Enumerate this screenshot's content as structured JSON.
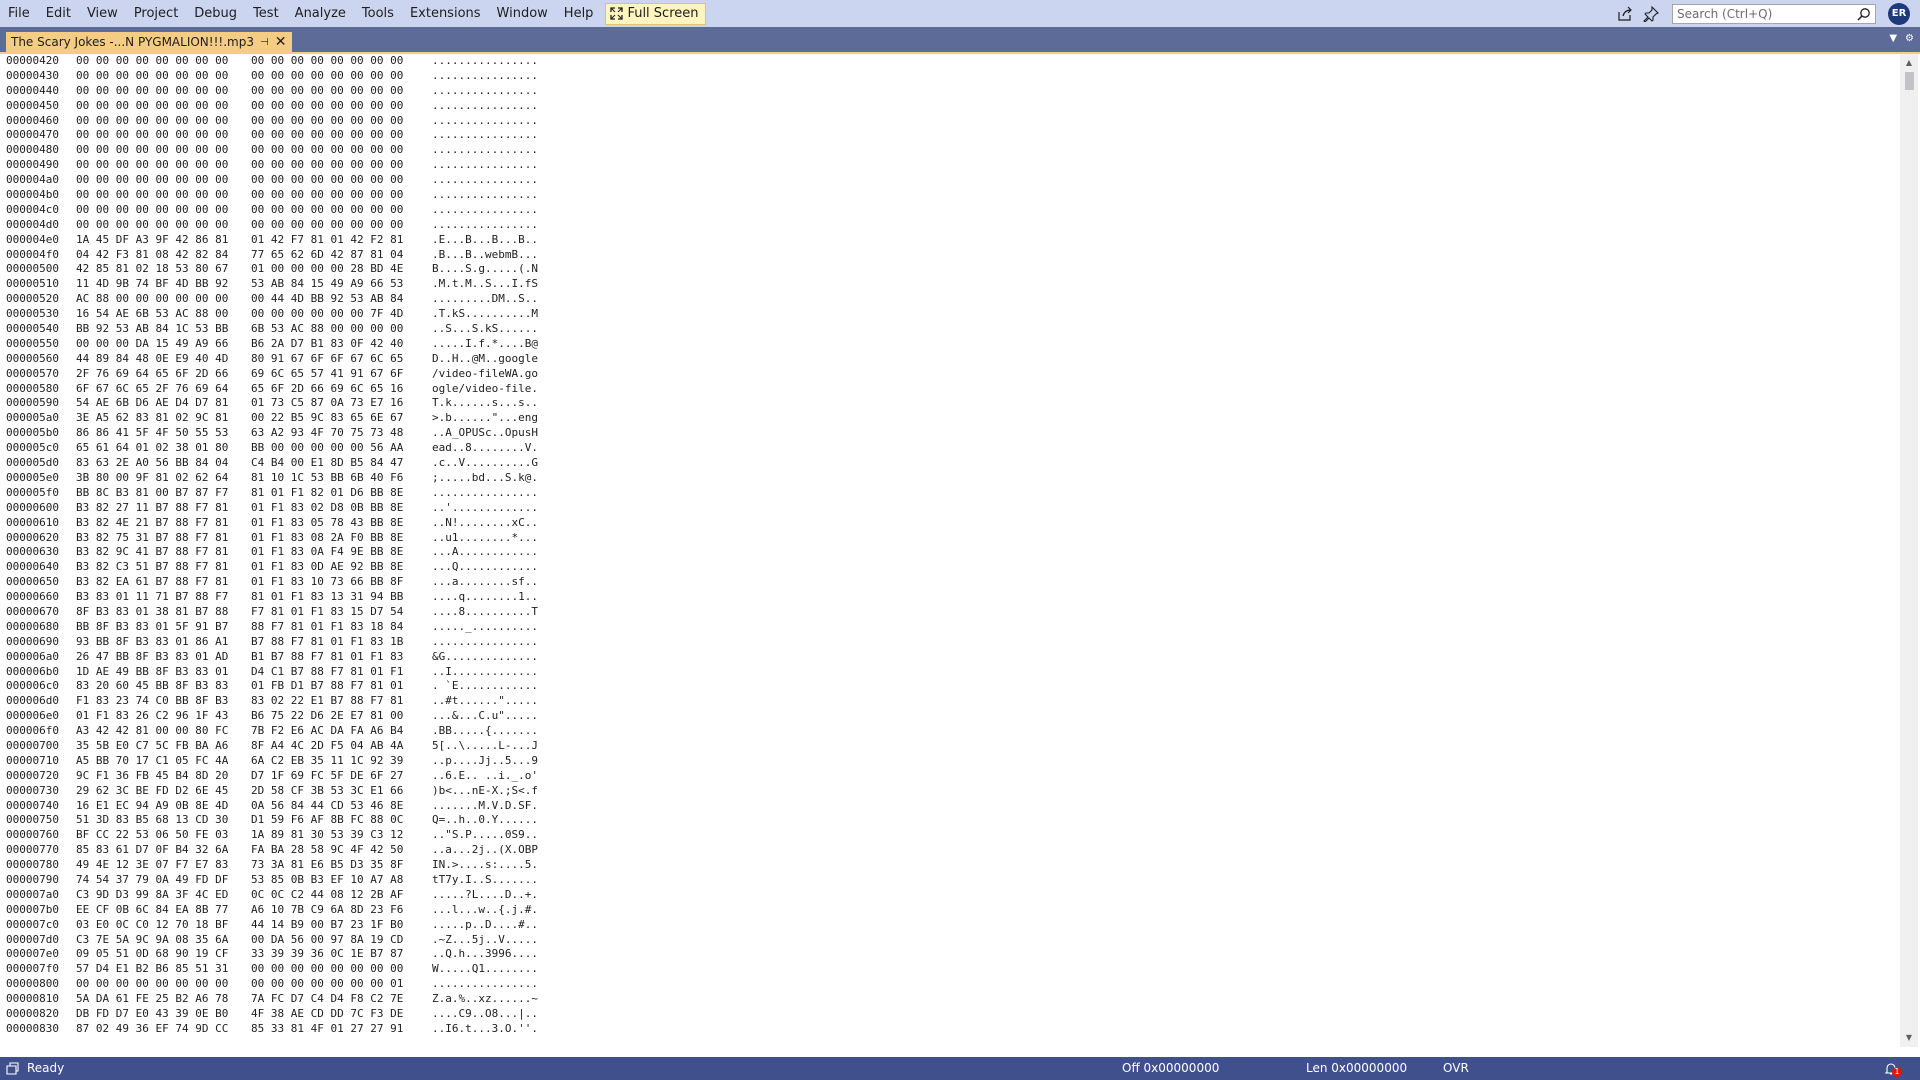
{
  "menubar": {
    "items": [
      "File",
      "Edit",
      "View",
      "Project",
      "Debug",
      "Test",
      "Analyze",
      "Tools",
      "Extensions",
      "Window",
      "Help"
    ],
    "fullscreen_label": "Full Screen",
    "search_placeholder": "Search (Ctrl+Q)",
    "avatar_initials": "ER"
  },
  "tab": {
    "title": "The Scary Jokes -...N PYGMALION!!!.mp3",
    "pin_glyph": "⊣",
    "close_glyph": "✕"
  },
  "hex_rows": [
    {
      "offset": "00000420",
      "hex1": "00 00 00 00 00 00 00 00",
      "hex2": "00 00 00 00 00 00 00 00",
      "ascii": "................"
    },
    {
      "offset": "00000430",
      "hex1": "00 00 00 00 00 00 00 00",
      "hex2": "00 00 00 00 00 00 00 00",
      "ascii": "................"
    },
    {
      "offset": "00000440",
      "hex1": "00 00 00 00 00 00 00 00",
      "hex2": "00 00 00 00 00 00 00 00",
      "ascii": "................"
    },
    {
      "offset": "00000450",
      "hex1": "00 00 00 00 00 00 00 00",
      "hex2": "00 00 00 00 00 00 00 00",
      "ascii": "................"
    },
    {
      "offset": "00000460",
      "hex1": "00 00 00 00 00 00 00 00",
      "hex2": "00 00 00 00 00 00 00 00",
      "ascii": "................"
    },
    {
      "offset": "00000470",
      "hex1": "00 00 00 00 00 00 00 00",
      "hex2": "00 00 00 00 00 00 00 00",
      "ascii": "................"
    },
    {
      "offset": "00000480",
      "hex1": "00 00 00 00 00 00 00 00",
      "hex2": "00 00 00 00 00 00 00 00",
      "ascii": "................"
    },
    {
      "offset": "00000490",
      "hex1": "00 00 00 00 00 00 00 00",
      "hex2": "00 00 00 00 00 00 00 00",
      "ascii": "................"
    },
    {
      "offset": "000004a0",
      "hex1": "00 00 00 00 00 00 00 00",
      "hex2": "00 00 00 00 00 00 00 00",
      "ascii": "................"
    },
    {
      "offset": "000004b0",
      "hex1": "00 00 00 00 00 00 00 00",
      "hex2": "00 00 00 00 00 00 00 00",
      "ascii": "................"
    },
    {
      "offset": "000004c0",
      "hex1": "00 00 00 00 00 00 00 00",
      "hex2": "00 00 00 00 00 00 00 00",
      "ascii": "................"
    },
    {
      "offset": "000004d0",
      "hex1": "00 00 00 00 00 00 00 00",
      "hex2": "00 00 00 00 00 00 00 00",
      "ascii": "................"
    },
    {
      "offset": "000004e0",
      "hex1": "1A 45 DF A3 9F 42 86 81",
      "hex2": "01 42 F7 81 01 42 F2 81",
      "ascii": ".E...B...B...B.."
    },
    {
      "offset": "000004f0",
      "hex1": "04 42 F3 81 08 42 82 84",
      "hex2": "77 65 62 6D 42 87 81 04",
      "ascii": ".B...B..webmB..."
    },
    {
      "offset": "00000500",
      "hex1": "42 85 81 02 18 53 80 67",
      "hex2": "01 00 00 00 00 28 BD 4E",
      "ascii": "B....S.g.....(.N"
    },
    {
      "offset": "00000510",
      "hex1": "11 4D 9B 74 BF 4D BB 92",
      "hex2": "53 AB 84 15 49 A9 66 53",
      "ascii": ".M.t.M..S...I.fS"
    },
    {
      "offset": "00000520",
      "hex1": "AC 88 00 00 00 00 00 00",
      "hex2": "00 44 4D BB 92 53 AB 84",
      "ascii": ".........DM..S.."
    },
    {
      "offset": "00000530",
      "hex1": "16 54 AE 6B 53 AC 88 00",
      "hex2": "00 00 00 00 00 00 7F 4D",
      "ascii": ".T.kS..........M"
    },
    {
      "offset": "00000540",
      "hex1": "BB 92 53 AB 84 1C 53 BB",
      "hex2": "6B 53 AC 88 00 00 00 00",
      "ascii": "..S...S.kS......"
    },
    {
      "offset": "00000550",
      "hex1": "00 00 00 DA 15 49 A9 66",
      "hex2": "B6 2A D7 B1 83 0F 42 40",
      "ascii": ".....I.f.*....B@"
    },
    {
      "offset": "00000560",
      "hex1": "44 89 84 48 0E E9 40 4D",
      "hex2": "80 91 67 6F 6F 67 6C 65",
      "ascii": "D..H..@M..google"
    },
    {
      "offset": "00000570",
      "hex1": "2F 76 69 64 65 6F 2D 66",
      "hex2": "69 6C 65 57 41 91 67 6F",
      "ascii": "/video-fileWA.go"
    },
    {
      "offset": "00000580",
      "hex1": "6F 67 6C 65 2F 76 69 64",
      "hex2": "65 6F 2D 66 69 6C 65 16",
      "ascii": "ogle/video-file."
    },
    {
      "offset": "00000590",
      "hex1": "54 AE 6B D6 AE D4 D7 81",
      "hex2": "01 73 C5 87 0A 73 E7 16",
      "ascii": "T.k......s...s.."
    },
    {
      "offset": "000005a0",
      "hex1": "3E A5 62 83 81 02 9C 81",
      "hex2": "00 22 B5 9C 83 65 6E 67",
      "ascii": ">.b......\"...eng"
    },
    {
      "offset": "000005b0",
      "hex1": "86 86 41 5F 4F 50 55 53",
      "hex2": "63 A2 93 4F 70 75 73 48",
      "ascii": "..A_OPUSc..OpusH"
    },
    {
      "offset": "000005c0",
      "hex1": "65 61 64 01 02 38 01 80",
      "hex2": "BB 00 00 00 00 00 56 AA",
      "ascii": "ead..8........V."
    },
    {
      "offset": "000005d0",
      "hex1": "83 63 2E A0 56 BB 84 04",
      "hex2": "C4 B4 00 E1 8D B5 84 47",
      "ascii": ".c..V..........G"
    },
    {
      "offset": "000005e0",
      "hex1": "3B 80 00 9F 81 02 62 64",
      "hex2": "81 10 1C 53 BB 6B 40 F6",
      "ascii": ";.....bd...S.k@."
    },
    {
      "offset": "000005f0",
      "hex1": "BB 8C B3 81 00 B7 87 F7",
      "hex2": "81 01 F1 82 01 D6 BB 8E",
      "ascii": "................"
    },
    {
      "offset": "00000600",
      "hex1": "B3 82 27 11 B7 88 F7 81",
      "hex2": "01 F1 83 02 D8 0B BB 8E",
      "ascii": "..'............."
    },
    {
      "offset": "00000610",
      "hex1": "B3 82 4E 21 B7 88 F7 81",
      "hex2": "01 F1 83 05 78 43 BB 8E",
      "ascii": "..N!........xC.."
    },
    {
      "offset": "00000620",
      "hex1": "B3 82 75 31 B7 88 F7 81",
      "hex2": "01 F1 83 08 2A F0 BB 8E",
      "ascii": "..u1........*..."
    },
    {
      "offset": "00000630",
      "hex1": "B3 82 9C 41 B7 88 F7 81",
      "hex2": "01 F1 83 0A F4 9E BB 8E",
      "ascii": "...A............"
    },
    {
      "offset": "00000640",
      "hex1": "B3 82 C3 51 B7 88 F7 81",
      "hex2": "01 F1 83 0D AE 92 BB 8E",
      "ascii": "...Q............"
    },
    {
      "offset": "00000650",
      "hex1": "B3 82 EA 61 B7 88 F7 81",
      "hex2": "01 F1 83 10 73 66 BB 8F",
      "ascii": "...a........sf.."
    },
    {
      "offset": "00000660",
      "hex1": "B3 83 01 11 71 B7 88 F7",
      "hex2": "81 01 F1 83 13 31 94 BB",
      "ascii": "....q........1.."
    },
    {
      "offset": "00000670",
      "hex1": "8F B3 83 01 38 81 B7 88",
      "hex2": "F7 81 01 F1 83 15 D7 54",
      "ascii": "....8..........T"
    },
    {
      "offset": "00000680",
      "hex1": "BB 8F B3 83 01 5F 91 B7",
      "hex2": "88 F7 81 01 F1 83 18 84",
      "ascii": "....._.........."
    },
    {
      "offset": "00000690",
      "hex1": "93 BB 8F B3 83 01 86 A1",
      "hex2": "B7 88 F7 81 01 F1 83 1B",
      "ascii": "................"
    },
    {
      "offset": "000006a0",
      "hex1": "26 47 BB 8F B3 83 01 AD",
      "hex2": "B1 B7 88 F7 81 01 F1 83",
      "ascii": "&G.............."
    },
    {
      "offset": "000006b0",
      "hex1": "1D AE 49 BB 8F B3 83 01",
      "hex2": "D4 C1 B7 88 F7 81 01 F1",
      "ascii": "..I............."
    },
    {
      "offset": "000006c0",
      "hex1": "83 20 60 45 BB 8F B3 83",
      "hex2": "01 FB D1 B7 88 F7 81 01",
      "ascii": ". `E............"
    },
    {
      "offset": "000006d0",
      "hex1": "F1 83 23 74 C0 BB 8F B3",
      "hex2": "83 02 22 E1 B7 88 F7 81",
      "ascii": "..#t......\"....."
    },
    {
      "offset": "000006e0",
      "hex1": "01 F1 83 26 C2 96 1F 43",
      "hex2": "B6 75 22 D6 2E E7 81 00",
      "ascii": "...&...C.u\"....."
    },
    {
      "offset": "000006f0",
      "hex1": "A3 42 42 81 00 00 80 FC",
      "hex2": "7B F2 E6 AC DA FA A6 B4",
      "ascii": ".BB.....{......."
    },
    {
      "offset": "00000700",
      "hex1": "35 5B E0 C7 5C FB BA A6",
      "hex2": "8F A4 4C 2D F5 04 AB 4A",
      "ascii": "5[..\\.....L-...J"
    },
    {
      "offset": "00000710",
      "hex1": "A5 BB 70 17 C1 05 FC 4A",
      "hex2": "6A C2 EB 35 11 1C 92 39",
      "ascii": "..p....Jj..5...9"
    },
    {
      "offset": "00000720",
      "hex1": "9C F1 36 FB 45 B4 8D 20",
      "hex2": "D7 1F 69 FC 5F DE 6F 27",
      "ascii": "..6.E.. ..i._.o'"
    },
    {
      "offset": "00000730",
      "hex1": "29 62 3C BE FD D2 6E 45",
      "hex2": "2D 58 CF 3B 53 3C E1 66",
      "ascii": ")b<...nE-X.;S<.f"
    },
    {
      "offset": "00000740",
      "hex1": "16 E1 EC 94 A9 0B 8E 4D",
      "hex2": "0A 56 84 44 CD 53 46 8E",
      "ascii": ".......M.V.D.SF."
    },
    {
      "offset": "00000750",
      "hex1": "51 3D 83 B5 68 13 CD 30",
      "hex2": "D1 59 F6 AF 8B FC 88 0C",
      "ascii": "Q=..h..0.Y......"
    },
    {
      "offset": "00000760",
      "hex1": "BF CC 22 53 06 50 FE 03",
      "hex2": "1A 89 81 30 53 39 C3 12",
      "ascii": "..\"S.P.....0S9.."
    },
    {
      "offset": "00000770",
      "hex1": "85 83 61 D7 0F B4 32 6A",
      "hex2": "FA BA 28 58 9C 4F 42 50",
      "ascii": "..a...2j..(X.OBP"
    },
    {
      "offset": "00000780",
      "hex1": "49 4E 12 3E 07 F7 E7 83",
      "hex2": "73 3A 81 E6 B5 D3 35 8F",
      "ascii": "IN.>....s:....5."
    },
    {
      "offset": "00000790",
      "hex1": "74 54 37 79 0A 49 FD DF",
      "hex2": "53 85 0B B3 EF 10 A7 A8",
      "ascii": "tT7y.I..S......."
    },
    {
      "offset": "000007a0",
      "hex1": "C3 9D D3 99 8A 3F 4C ED",
      "hex2": "0C 0C C2 44 08 12 2B AF",
      "ascii": ".....?L....D..+."
    },
    {
      "offset": "000007b0",
      "hex1": "EE CF 0B 6C 84 EA 8B 77",
      "hex2": "A6 10 7B C9 6A 8D 23 F6",
      "ascii": "...l...w..{.j.#."
    },
    {
      "offset": "000007c0",
      "hex1": "03 E0 0C C0 12 70 18 BF",
      "hex2": "44 14 B9 00 B7 23 1F B0",
      "ascii": ".....p..D....#.."
    },
    {
      "offset": "000007d0",
      "hex1": "C3 7E 5A 9C 9A 08 35 6A",
      "hex2": "00 DA 56 00 97 8A 19 CD",
      "ascii": ".~Z...5j..V....."
    },
    {
      "offset": "000007e0",
      "hex1": "09 05 51 0D 68 90 19 CF",
      "hex2": "33 39 39 36 0C 1E B7 87",
      "ascii": "..Q.h...3996...."
    },
    {
      "offset": "000007f0",
      "hex1": "57 D4 E1 B2 B6 85 51 31",
      "hex2": "00 00 00 00 00 00 00 00",
      "ascii": "W.....Q1........"
    },
    {
      "offset": "00000800",
      "hex1": "00 00 00 00 00 00 00 00",
      "hex2": "00 00 00 00 00 00 00 01",
      "ascii": "................"
    },
    {
      "offset": "00000810",
      "hex1": "5A DA 61 FE 25 B2 A6 78",
      "hex2": "7A FC D7 C4 D4 F8 C2 7E",
      "ascii": "Z.a.%..xz......~"
    },
    {
      "offset": "00000820",
      "hex1": "DB FD D7 E0 43 39 0E B0",
      "hex2": "4F 38 AE CD DD 7C F3 DE",
      "ascii": "....C9..O8...|.."
    },
    {
      "offset": "00000830",
      "hex1": "87 02 49 36 EF 74 9D CC",
      "hex2": "85 33 81 4F 01 27 27 91",
      "ascii": "..I6.t...3.O.''."
    }
  ],
  "statusbar": {
    "ready": "Ready",
    "offset": "Off 0x00000000",
    "length": "Len 0x00000000",
    "mode": "OVR",
    "notification_count": "1"
  }
}
